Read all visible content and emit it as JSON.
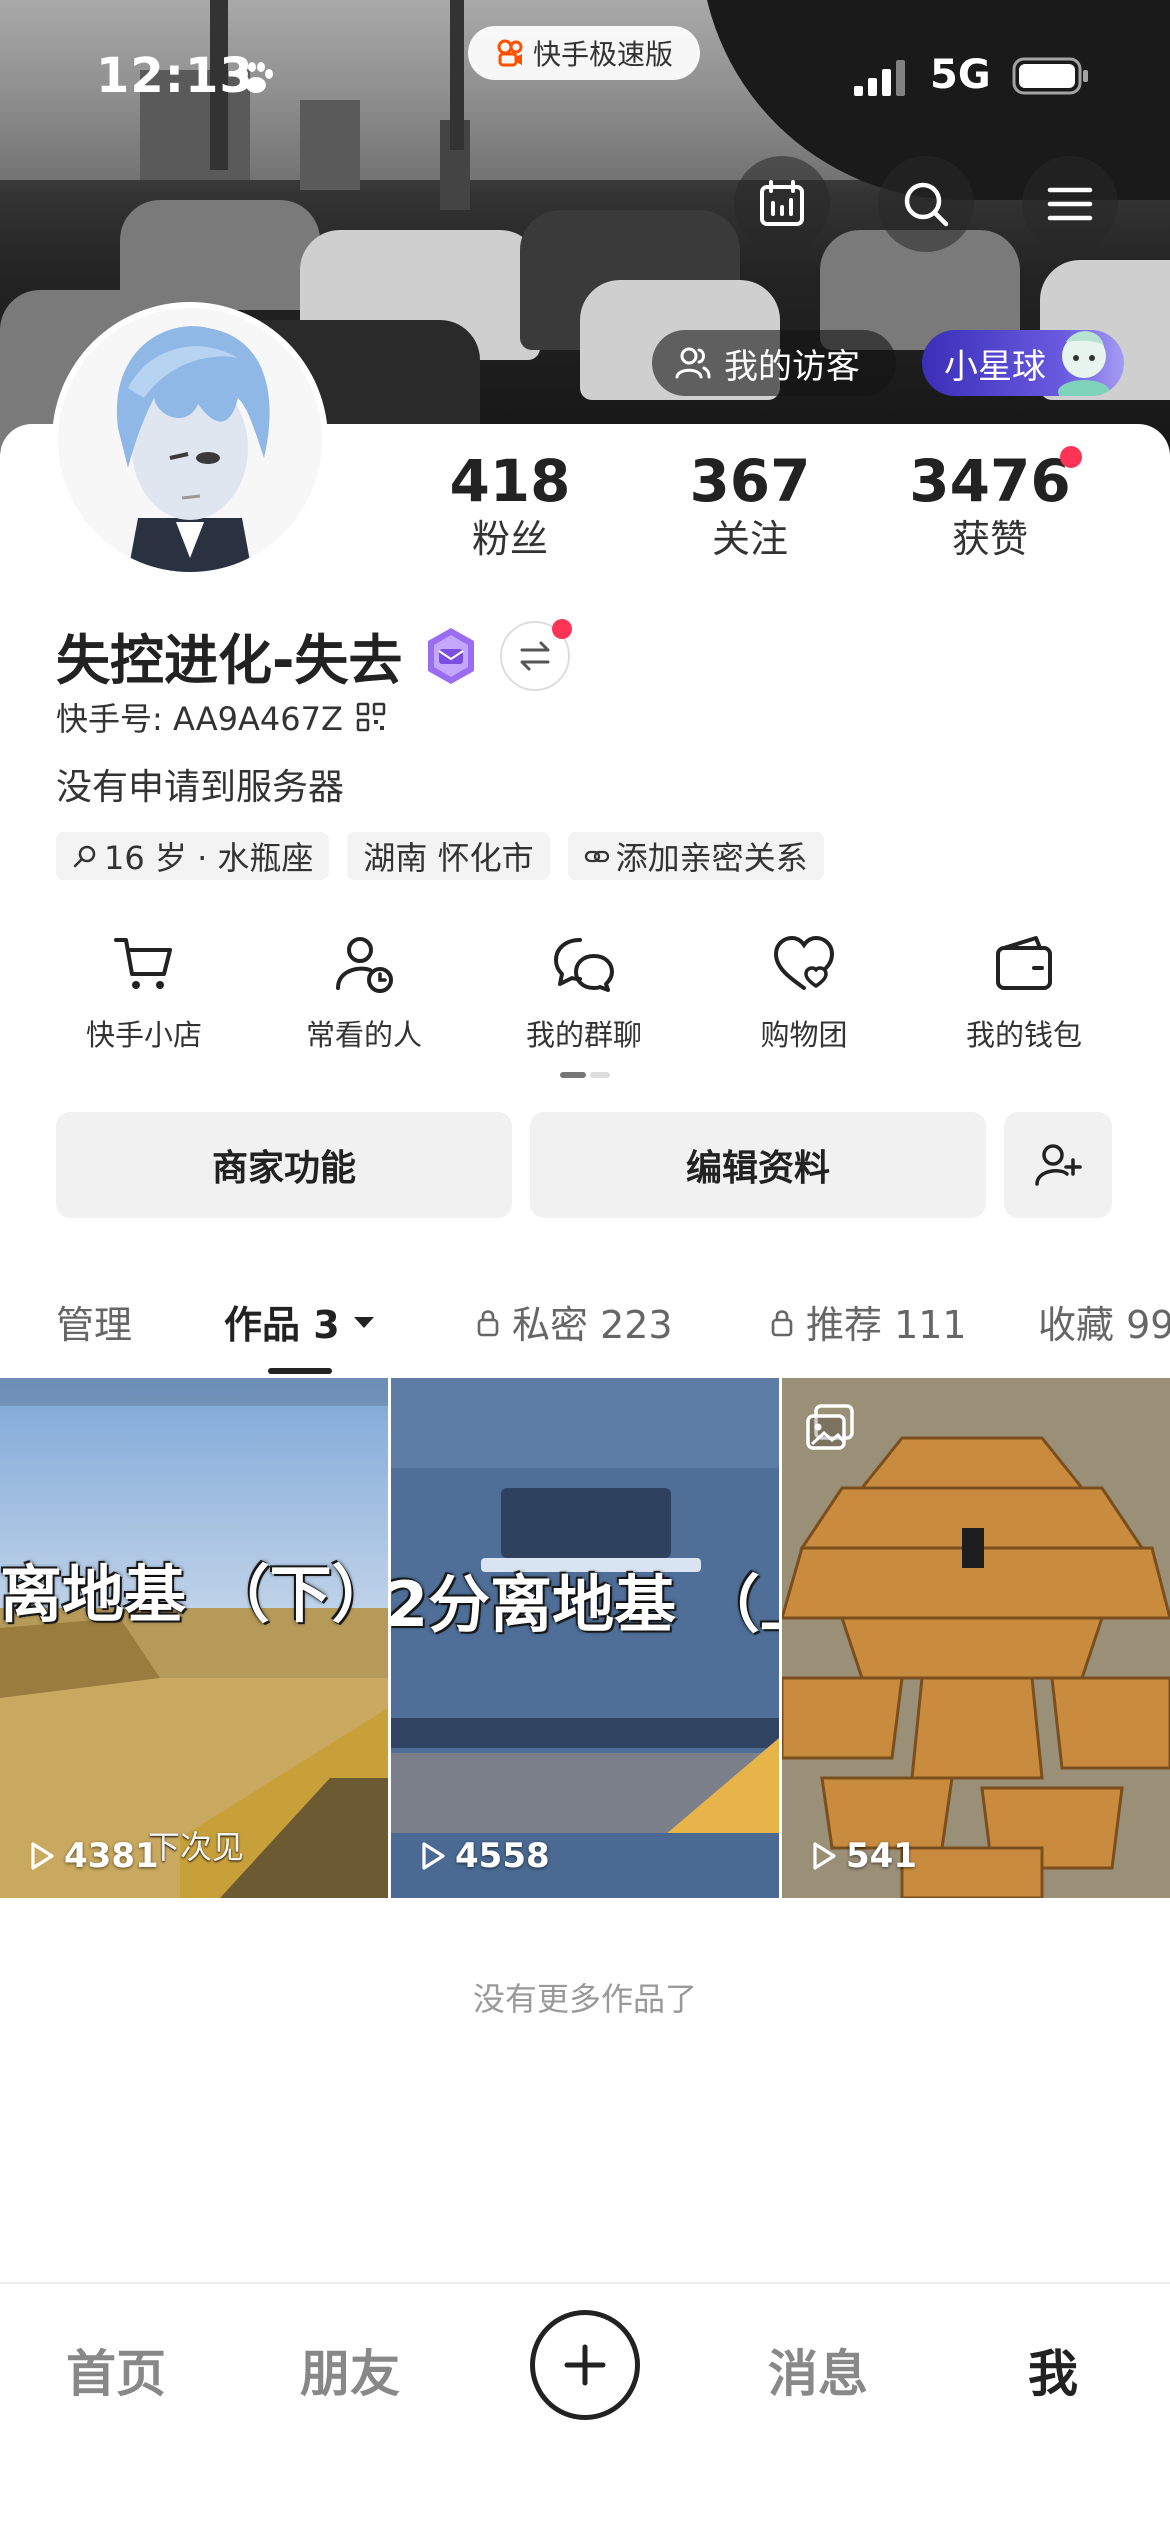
{
  "status_bar": {
    "time": "12:13",
    "network": "5G",
    "app_pill": "快手极速版",
    "icons": [
      "paw-icon",
      "signal-icon",
      "battery-icon"
    ]
  },
  "header": {
    "visitors_label": "我的访客",
    "planet_label": "小星球",
    "icons": [
      "calendar-icon",
      "search-icon",
      "menu-icon"
    ]
  },
  "profile": {
    "stats": [
      {
        "value": "418",
        "label": "粉丝"
      },
      {
        "value": "367",
        "label": "关注"
      },
      {
        "value": "3476",
        "label": "获赞"
      }
    ],
    "name": "失控进化-失去",
    "kuaishou_id": "快手号: AA9A467Z",
    "bio": "没有申请到服务器",
    "tags": [
      "16 岁 · 水瓶座",
      "湖南 怀化市",
      "添加亲密关系"
    ]
  },
  "shortcuts": [
    {
      "label": "快手小店",
      "icon": "cart-icon"
    },
    {
      "label": "常看的人",
      "icon": "user-clock-icon"
    },
    {
      "label": "我的群聊",
      "icon": "chat-bubbles-icon"
    },
    {
      "label": "购物团",
      "icon": "heart-bag-icon"
    },
    {
      "label": "我的钱包",
      "icon": "wallet-icon"
    }
  ],
  "actions": {
    "merchant": "商家功能",
    "edit_profile": "编辑资料"
  },
  "tabs": [
    {
      "label": "管理"
    },
    {
      "label": "作品 3"
    },
    {
      "label": "私密 223"
    },
    {
      "label": "推荐 111"
    },
    {
      "label": "收藏 99"
    }
  ],
  "works": [
    {
      "caption": "离地基 （下）",
      "plays": "4381",
      "sub": "下次见"
    },
    {
      "caption": "2分离地基 （上",
      "plays": "4558"
    },
    {
      "plays": "541"
    }
  ],
  "empty_text": "没有更多作品了",
  "bottom_nav": {
    "home": "首页",
    "friends": "朋友",
    "messages": "消息",
    "me": "我"
  },
  "colors": {
    "accent_red": "#fe3355",
    "planet_purple": "#4b3fc8"
  }
}
